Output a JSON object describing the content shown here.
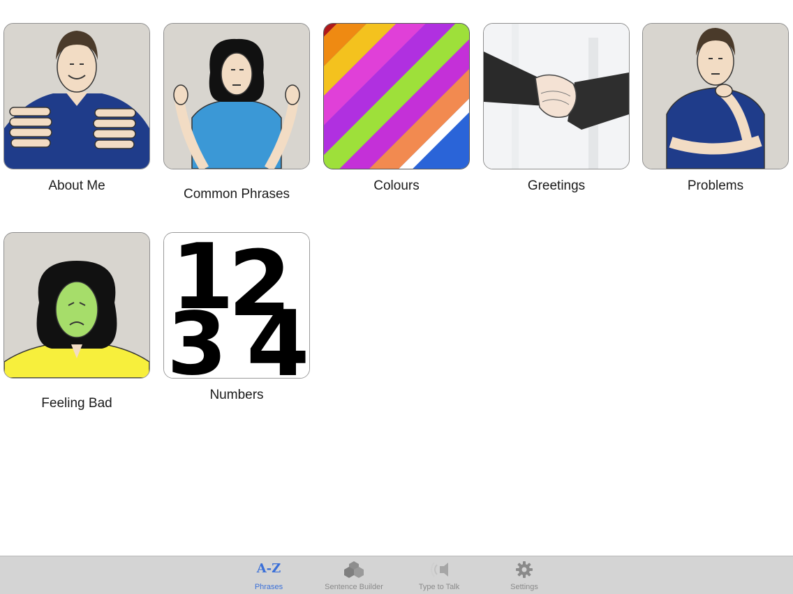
{
  "categories": [
    {
      "label": "About Me",
      "icon": "man-pointing-self-icon"
    },
    {
      "label": "Common Phrases",
      "icon": "woman-shrugging-icon"
    },
    {
      "label": "Colours",
      "icon": "rainbow-stripes-icon"
    },
    {
      "label": "Greetings",
      "icon": "handshake-icon"
    },
    {
      "label": "Problems",
      "icon": "man-thinking-icon"
    },
    {
      "label": "Feeling Bad",
      "icon": "sick-woman-icon"
    },
    {
      "label": "Numbers",
      "icon": "numbers-icon",
      "digits": [
        "1",
        "2",
        "3",
        "4"
      ]
    }
  ],
  "tabbar": {
    "active": "Phrases",
    "tabs": [
      {
        "label": "Phrases",
        "glyph": "A-Z",
        "icon": "az-icon"
      },
      {
        "label": "Sentence Builder",
        "icon": "blocks-icon"
      },
      {
        "label": "Type to Talk",
        "icon": "speaker-icon"
      },
      {
        "label": "Settings",
        "icon": "gear-icon"
      }
    ]
  },
  "colors": {
    "accent": "#3a6fd8",
    "tabbar_bg": "#d4d4d4",
    "shirt_navy": "#1f3c8a",
    "shirt_blue": "#3b98d6",
    "sick_face": "#a6dd6a",
    "yellow_top": "#f7ef3c"
  }
}
